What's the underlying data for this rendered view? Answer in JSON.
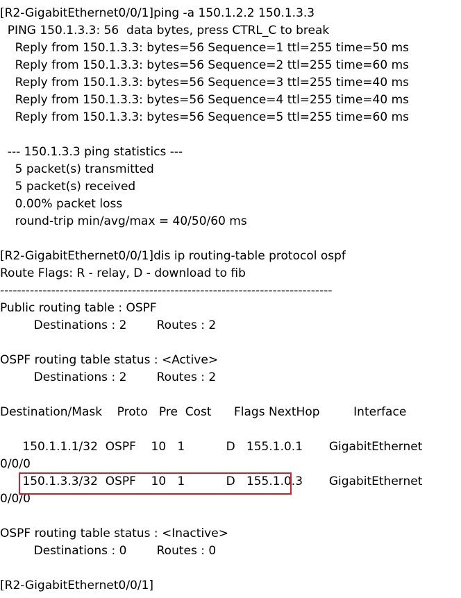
{
  "terminal": {
    "lines": [
      "[R2-GigabitEthernet0/0/1]ping -a 150.1.2.2 150.1.3.3",
      "  PING 150.1.3.3: 56  data bytes, press CTRL_C to break",
      "    Reply from 150.1.3.3: bytes=56 Sequence=1 ttl=255 time=50 ms",
      "    Reply from 150.1.3.3: bytes=56 Sequence=2 ttl=255 time=60 ms",
      "    Reply from 150.1.3.3: bytes=56 Sequence=3 ttl=255 time=40 ms",
      "    Reply from 150.1.3.3: bytes=56 Sequence=4 ttl=255 time=40 ms",
      "    Reply from 150.1.3.3: bytes=56 Sequence=5 ttl=255 time=60 ms",
      "",
      "  --- 150.1.3.3 ping statistics ---",
      "    5 packet(s) transmitted",
      "    5 packet(s) received",
      "    0.00% packet loss",
      "    round-trip min/avg/max = 40/50/60 ms",
      "",
      "[R2-GigabitEthernet0/0/1]dis ip routing-table protocol ospf",
      "Route Flags: R - relay, D - download to fib",
      "------------------------------------------------------------------------------",
      "Public routing table : OSPF",
      "         Destinations : 2        Routes : 2",
      "",
      "OSPF routing table status : <Active>",
      "         Destinations : 2        Routes : 2",
      "",
      "Destination/Mask    Proto   Pre  Cost      Flags NextHop         Interface",
      "",
      "      150.1.1.1/32  OSPF    10   1           D   155.1.0.1       GigabitEthernet",
      "0/0/0",
      "      150.1.3.3/32  OSPF    10   1           D   155.1.0.3       GigabitEthernet",
      "0/0/0",
      "",
      "OSPF routing table status : <Inactive>",
      "         Destinations : 0        Routes : 0",
      "",
      "[R2-GigabitEthernet0/0/1]"
    ],
    "highlight_color": "#d0202a"
  }
}
